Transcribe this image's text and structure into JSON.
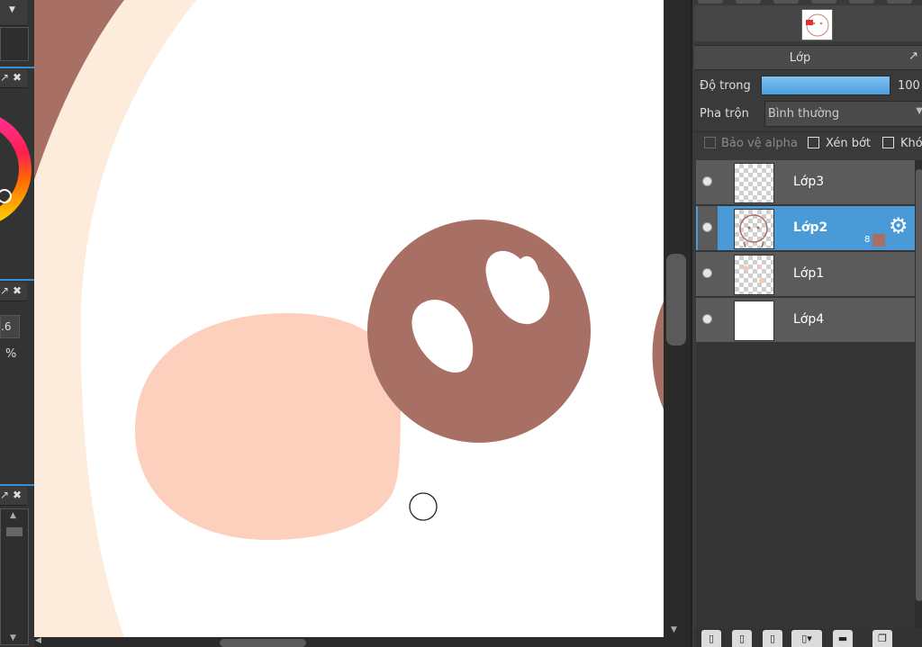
{
  "left_panel": {
    "numeric_value": ".6",
    "unit": "%"
  },
  "layer_panel": {
    "title": "Lớp",
    "opacity_label": "Độ trong",
    "opacity_value": "100",
    "opacity_percent": 100,
    "blend_label": "Pha trộn",
    "blend_value": "Bình thường",
    "checkbox_protect_alpha": "Bảo vệ alpha",
    "checkbox_clipping": "Xén bớt",
    "checkbox_lock": "Khó",
    "layers": [
      {
        "name": "Lớp3",
        "visible": true,
        "selected": false
      },
      {
        "name": "Lớp2",
        "visible": true,
        "selected": true,
        "bit_depth": "8"
      },
      {
        "name": "Lớp1",
        "visible": true,
        "selected": false
      },
      {
        "name": "Lớp4",
        "visible": true,
        "selected": false
      }
    ]
  },
  "icons": {
    "popout": "popout-icon",
    "close": "close-icon",
    "gear": "gear-icon",
    "eye": "eye-icon",
    "chevron": "chevron-down-icon"
  },
  "colors": {
    "accent": "#4a9ad8",
    "canvas_brown": "#a87064",
    "canvas_peach": "#fdd0bd",
    "canvas_cream": "#fdebdc"
  }
}
